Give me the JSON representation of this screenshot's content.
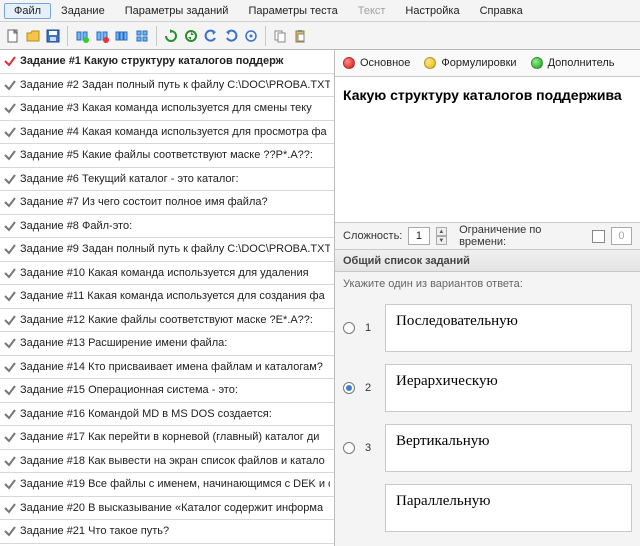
{
  "menu": {
    "items": [
      {
        "label": "Файл",
        "active": true
      },
      {
        "label": "Задание"
      },
      {
        "label": "Параметры заданий"
      },
      {
        "label": "Параметры теста"
      },
      {
        "label": "Текст",
        "disabled": true
      },
      {
        "label": "Настройка"
      },
      {
        "label": "Справка"
      }
    ]
  },
  "toolbar_icons": [
    "new-icon",
    "open-icon",
    "save-icon",
    "sep",
    "add-task-icon",
    "delete-task-icon",
    "duplicate-task-icon",
    "task-group-icon",
    "sep",
    "refresh-icon",
    "sync-icon",
    "undo-icon",
    "redo-icon",
    "nav-icon",
    "sep",
    "copy-icon",
    "paste-icon"
  ],
  "tasks": [
    {
      "label": "Задание #1 Какую структуру каталогов поддерж",
      "selected": true
    },
    {
      "label": "Задание #2 Задан полный путь к файлу C:\\DOC\\PROBA.TXT"
    },
    {
      "label": "Задание #3 Какая    команда используется для смены теку"
    },
    {
      "label": "Задание #4 Какая команда используется для просмотра фа"
    },
    {
      "label": "Задание #5 Какие файлы соответствуют маске ??P*.A??:"
    },
    {
      "label": "Задание #6 Текущий каталог - это каталог:"
    },
    {
      "label": "Задание #7 Из чего состоит полное имя файла?"
    },
    {
      "label": "Задание #8 Файл-это:"
    },
    {
      "label": "Задание #9 Задан полный путь к файлу C:\\DOC\\PROBA.TXT"
    },
    {
      "label": "Задание #10 Какая команда используется для удаления"
    },
    {
      "label": "Задание #11 Какая команда используется для создания фа"
    },
    {
      "label": "Задание #12 Какие файлы соответствуют маске ?E*.A??:"
    },
    {
      "label": "Задание #13 Расширение имени файла:"
    },
    {
      "label": "Задание #14 Кто присваивает имена файлам и каталогам?"
    },
    {
      "label": "Задание #15 Операционная система - это:"
    },
    {
      "label": "Задание #16 Командой MD в MS DOS создается:"
    },
    {
      "label": "Задание #17 Как перейти в корневой (главный) каталог ди"
    },
    {
      "label": "Задание #18 Как вывести на экран список файлов и катало"
    },
    {
      "label": "Задание #19 Все файлы с именем, начинающимся с DEK и с"
    },
    {
      "label": "Задание #20 В высказывание «Каталог содержит информа"
    },
    {
      "label": "Задание #21 Что такое путь?"
    }
  ],
  "tabs": [
    {
      "label": "Основное",
      "dot": "red"
    },
    {
      "label": "Формулировки",
      "dot": "yellow"
    },
    {
      "label": "Дополнитель",
      "dot": "green"
    }
  ],
  "question": {
    "text": "Какую структуру каталогов поддержива"
  },
  "params": {
    "difficulty_label": "Сложность:",
    "difficulty_value": "1",
    "time_label": "Ограничение по времени:",
    "time_value": "0"
  },
  "section": {
    "title": "Общий список заданий"
  },
  "answers": {
    "hint": "Укажите один из вариантов ответа:",
    "items": [
      {
        "num": "1",
        "text": "Последовательную",
        "checked": false
      },
      {
        "num": "2",
        "text": "Иерархическую",
        "checked": true
      },
      {
        "num": "3",
        "text": "Вертикальную",
        "checked": false
      },
      {
        "num": "",
        "text": "Параллельную",
        "checked": false
      }
    ]
  }
}
